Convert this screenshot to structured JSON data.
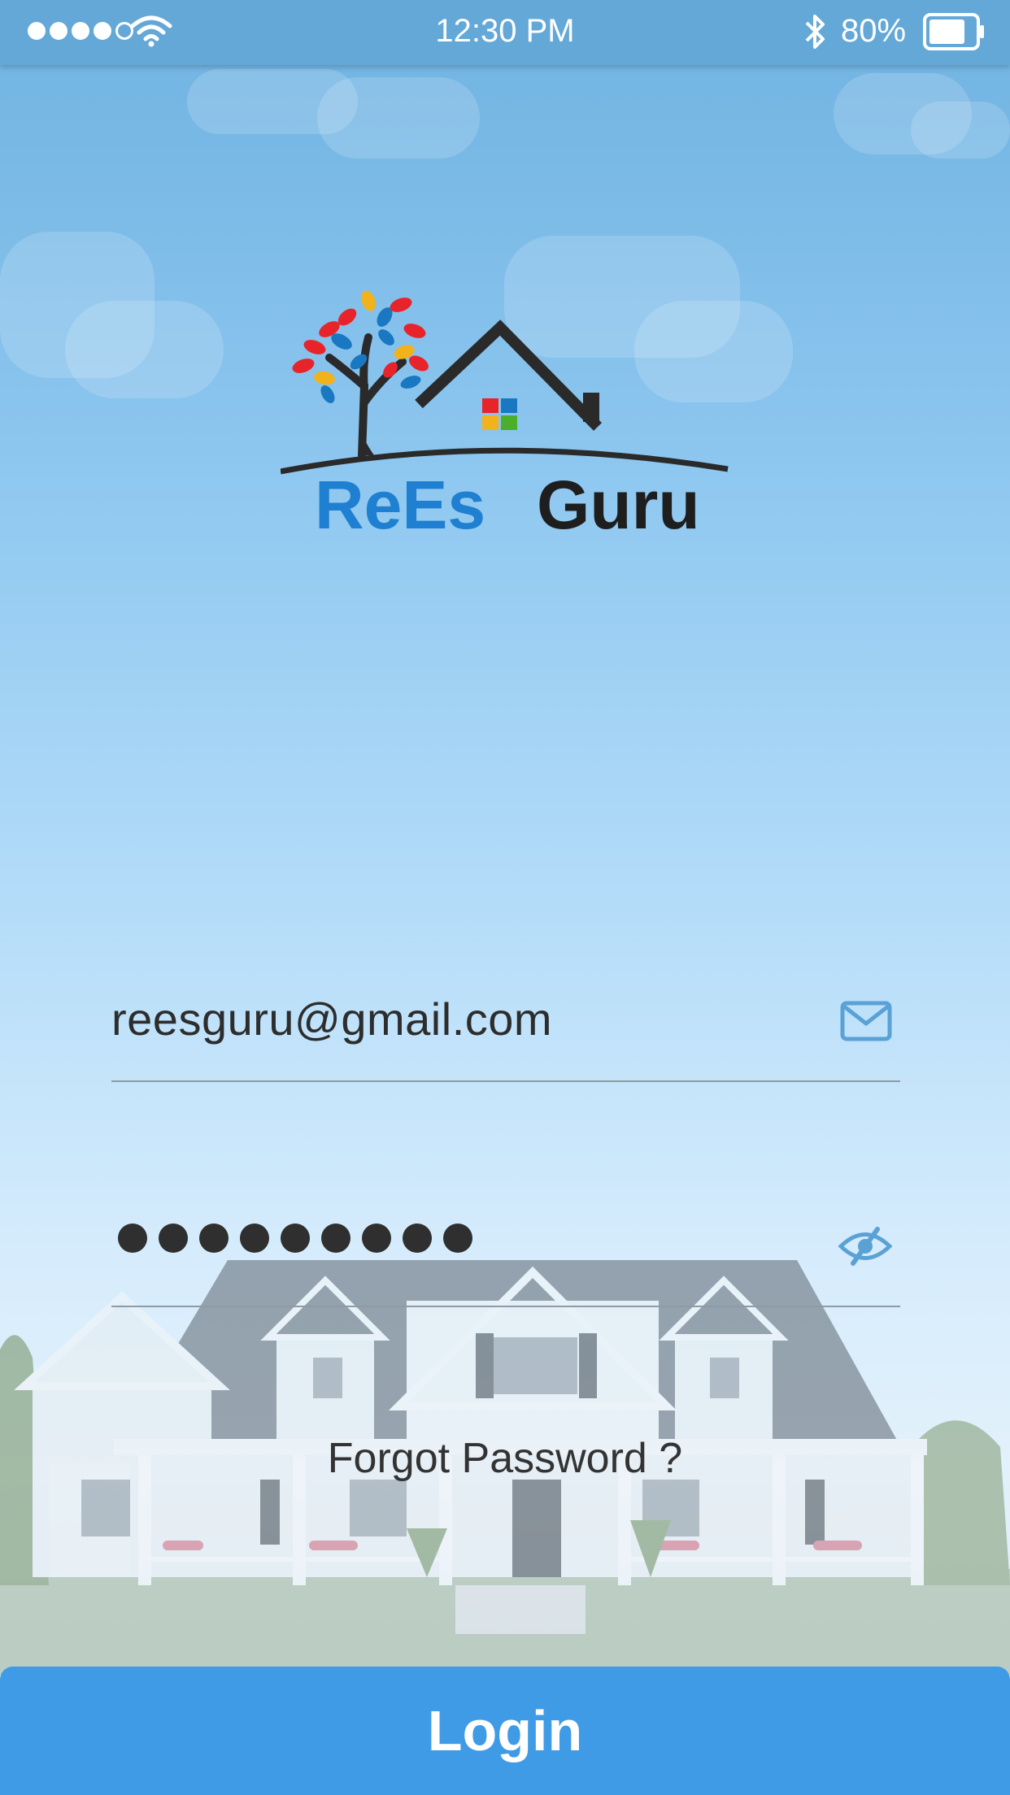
{
  "status_bar": {
    "time": "12:30 PM",
    "battery_percent": "80%",
    "battery_level": 0.8,
    "signal_bars_filled": 4,
    "signal_bars_total": 5,
    "icons": [
      "signal-dots-icon",
      "wifi-icon",
      "bluetooth-icon",
      "battery-icon"
    ]
  },
  "logo": {
    "word1": "ReEs",
    "word2": "Guru",
    "colors": {
      "word1": "#1f7fd0",
      "word2": "#1e1e1e",
      "roof": "#2a2a2a"
    }
  },
  "form": {
    "email": {
      "value": "reesguru@gmail.com",
      "icon": "mail-icon"
    },
    "password": {
      "masked_length": 9,
      "icon": "eye-slash-icon"
    },
    "forgot_label": "Forgot Password ?"
  },
  "login_button": {
    "label": "Login",
    "color": "#3f9be6"
  },
  "colors": {
    "status_bar": "#64a8d8",
    "accent_icon": "#5aa2d5"
  }
}
